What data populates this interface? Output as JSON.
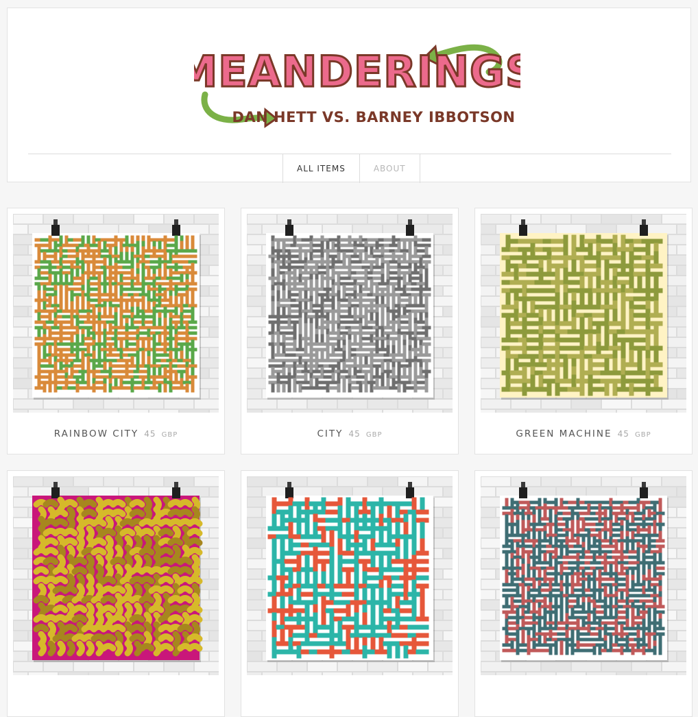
{
  "brand": {
    "logo_title": "MEANDERINGS",
    "logo_subtitle": "DAN HETT VS. BARNEY IBBOTSON",
    "title_color": "#ec6a8c",
    "outline_color": "#7a3828",
    "arrow_color": "#7bb147"
  },
  "nav": {
    "items": [
      {
        "label": "ALL ITEMS",
        "state": "active"
      },
      {
        "label": "ABOUT",
        "state": "inactive"
      }
    ]
  },
  "products": [
    {
      "title": "RAINBOW CITY",
      "price": "45",
      "currency": "GBP",
      "poster_bg": "#ffffff",
      "fill": "#d98a3a",
      "fill2": "#5aa84a",
      "style": "dense"
    },
    {
      "title": "CITY",
      "price": "45",
      "currency": "GBP",
      "poster_bg": "#ffffff",
      "fill": "#9a9a9a",
      "fill2": "#6f6f6f",
      "style": "dense"
    },
    {
      "title": "GREEN MACHINE",
      "price": "45",
      "currency": "GBP",
      "poster_bg": "#fff3c4",
      "fill": "#8d9a3c",
      "fill2": "#b0ae52",
      "style": "wide"
    },
    {
      "title": "",
      "price": "",
      "currency": "",
      "poster_bg": "#c9177a",
      "fill": "#d6b92a",
      "fill2": "#a7861e",
      "style": "curvy"
    },
    {
      "title": "",
      "price": "",
      "currency": "",
      "poster_bg": "#ffffff",
      "fill": "#2cb5a8",
      "fill2": "#e6573a",
      "style": "wide"
    },
    {
      "title": "",
      "price": "",
      "currency": "",
      "poster_bg": "#ffffff",
      "fill": "#3f6e74",
      "fill2": "#c05a5a",
      "style": "dense"
    }
  ]
}
